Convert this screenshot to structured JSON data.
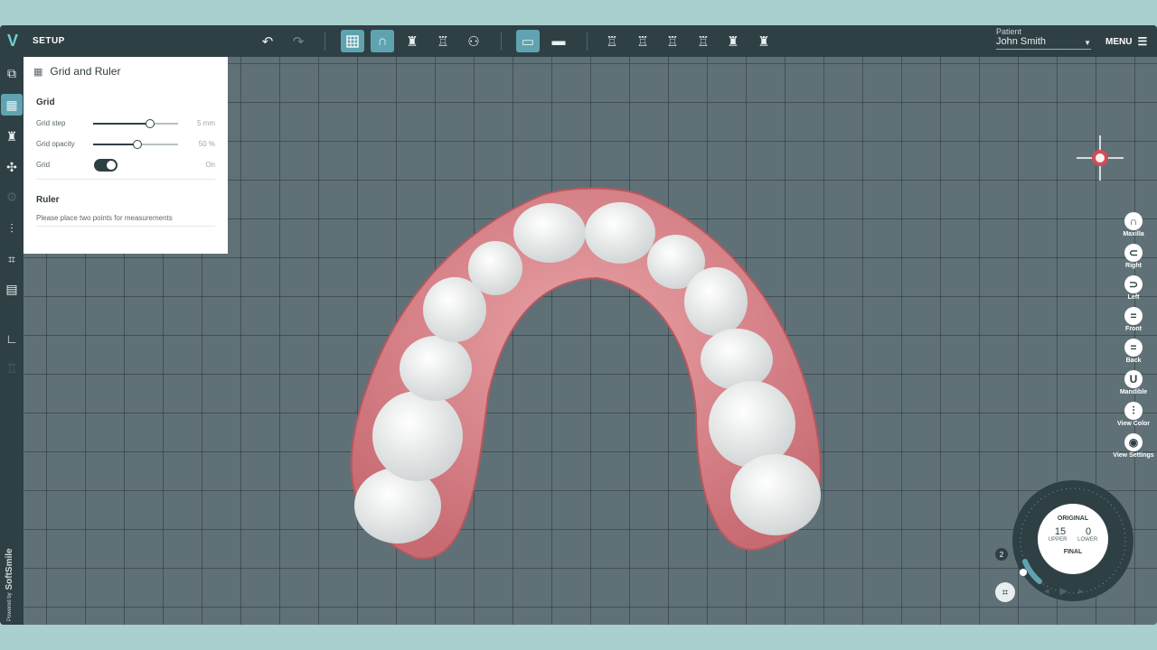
{
  "app": {
    "mode_label": "SETUP",
    "logo": "V"
  },
  "toolbar": {
    "undo_icon": "undo-icon",
    "redo_icon": "redo-icon",
    "buttons": [
      "grid-icon",
      "arch-icon",
      "tooth-icon",
      "tooth-icon",
      "teeth-icon",
      "jaw-view-icon",
      "jaw-view-icon",
      "tooth-icon",
      "tooth-icon",
      "tooth-icon",
      "tooth-icon",
      "tooth-icon",
      "tooth-icon"
    ]
  },
  "patient": {
    "label": "Patient",
    "name": "John Smith"
  },
  "menu": {
    "label": "MENU"
  },
  "panel": {
    "title": "Grid and Ruler",
    "grid_section": "Grid",
    "grid_step_label": "Grid step",
    "grid_step_value": "5 mm",
    "grid_step_fraction": 0.67,
    "grid_opacity_label": "Grid opacity",
    "grid_opacity_value": "50 %",
    "grid_opacity_fraction": 0.52,
    "grid_toggle_label": "Grid",
    "grid_toggle_value": "On",
    "ruler_section": "Ruler",
    "ruler_hint": "Please place two points for measurements"
  },
  "views": [
    {
      "label": "Maxilla",
      "glyph": "∩"
    },
    {
      "label": "Right",
      "glyph": "⊂"
    },
    {
      "label": "Left",
      "glyph": "⊃"
    },
    {
      "label": "Front",
      "glyph": "="
    },
    {
      "label": "Back",
      "glyph": "="
    },
    {
      "label": "Mandible",
      "glyph": "U"
    },
    {
      "label": "View Color",
      "glyph": "⫶"
    },
    {
      "label": "View Settings",
      "glyph": "◉"
    }
  ],
  "dial": {
    "top_label": "ORIGINAL",
    "upper_count": "15",
    "lower_count": "0",
    "upper_label": "UPPER",
    "lower_label": "LOWER",
    "bottom_label": "FINAL",
    "badge": "2"
  },
  "brand": {
    "powered": "Powered by",
    "name": "SoftSmile"
  },
  "colors": {
    "accent": "#5fa3b0",
    "bar": "#2f4045",
    "gum": "#d9848a"
  }
}
